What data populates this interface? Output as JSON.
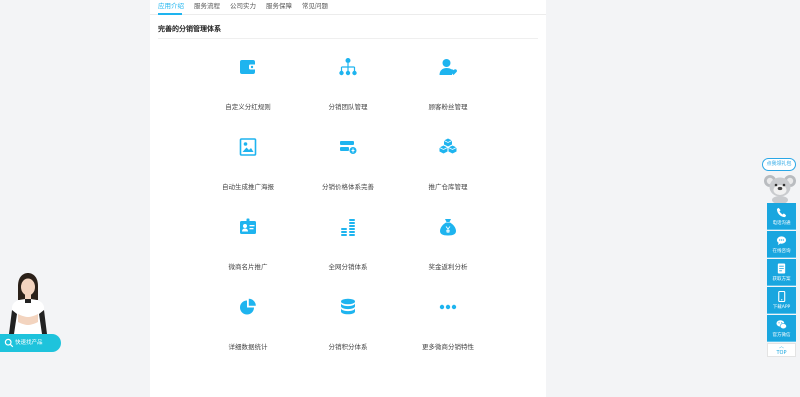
{
  "tabs": [
    {
      "label": "应用介绍",
      "active": true
    },
    {
      "label": "服务流程",
      "active": false
    },
    {
      "label": "公司实力",
      "active": false
    },
    {
      "label": "服务保障",
      "active": false
    },
    {
      "label": "常见问题",
      "active": false
    }
  ],
  "section_title": "完善的分销管理体系",
  "accent_color": "#1eb4ef",
  "features": [
    {
      "label": "自定义分红规则",
      "icon": "wallet-icon"
    },
    {
      "label": "分销团队管理",
      "icon": "team-tree-icon"
    },
    {
      "label": "顾客粉丝管理",
      "icon": "user-heart-icon"
    },
    {
      "label": "自动生成推广海报",
      "icon": "poster-image-icon"
    },
    {
      "label": "分销价格体系完善",
      "icon": "price-card-icon"
    },
    {
      "label": "推广仓库管理",
      "icon": "boxes-icon"
    },
    {
      "label": "微商名片推广",
      "icon": "id-card-icon"
    },
    {
      "label": "全网分销体系",
      "icon": "coin-stack-icon"
    },
    {
      "label": "奖金返利分析",
      "icon": "money-bag-icon"
    },
    {
      "label": "详细数据统计",
      "icon": "pie-chart-icon"
    },
    {
      "label": "分销积分体系",
      "icon": "database-icon"
    },
    {
      "label": "更多微商分销特性",
      "icon": "more-dots-icon"
    }
  ],
  "sidebar": {
    "bubble": "点我领礼包",
    "buttons": [
      {
        "label": "电话沟通",
        "icon": "phone-icon"
      },
      {
        "label": "在线咨询",
        "icon": "chat-icon"
      },
      {
        "label": "获取方案",
        "icon": "document-icon"
      },
      {
        "label": "下载APP",
        "icon": "mobile-icon"
      },
      {
        "label": "官方微信",
        "icon": "wechat-icon"
      }
    ],
    "top_label": "TOP"
  },
  "quick": {
    "label": "快速找产品",
    "icon": "search-icon"
  }
}
